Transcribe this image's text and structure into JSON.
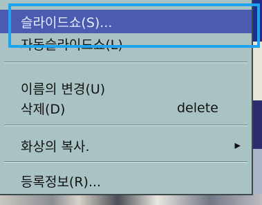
{
  "menu": {
    "items": [
      {
        "label": "슬라이드쇼(S)...",
        "selected": true
      },
      {
        "label": "자동슬라이드쇼(L)",
        "selected": false
      },
      {
        "label": "이름의 변경(U)"
      },
      {
        "label": "삭제(D)",
        "shortcut": "delete"
      },
      {
        "label": "화상의 복사.",
        "submenu_icon": "triangle-right-icon"
      },
      {
        "label": "등록정보(R)..."
      }
    ]
  },
  "colors": {
    "menu_bg": "#a9c3c4",
    "selected_bg": "#4a5bb0",
    "annotation_box": "#1fa2f0"
  }
}
